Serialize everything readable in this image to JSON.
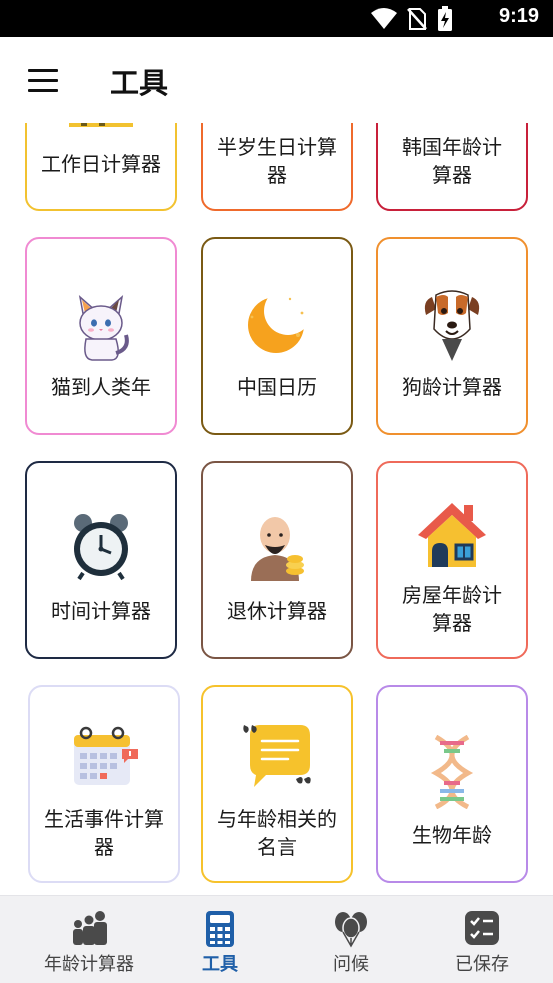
{
  "status_bar": {
    "time": "9:19",
    "icons": [
      "wifi-icon",
      "no-sim-icon",
      "battery-charging-icon"
    ]
  },
  "app_bar": {
    "menu_icon": "hamburger-menu-icon",
    "title": "工具"
  },
  "cards": [
    {
      "label": "工作日计算器",
      "icon": "workday-calendar-icon",
      "border": "#f2c230"
    },
    {
      "label": "半岁生日计算器",
      "icon": "half-birthday-icon",
      "border": "#ef6a2c"
    },
    {
      "label": "韩国年龄计算器",
      "icon": "korean-age-icon",
      "border": "#c8203a"
    },
    {
      "label": "猫到人类年",
      "icon": "cat-icon",
      "border": "#f08ad2"
    },
    {
      "label": "中国日历",
      "icon": "crescent-moon-icon",
      "border": "#7a5a14"
    },
    {
      "label": "狗龄计算器",
      "icon": "dog-icon",
      "border": "#f0902e"
    },
    {
      "label": "时间计算器",
      "icon": "alarm-clock-icon",
      "border": "#1e2a44"
    },
    {
      "label": "退休计算器",
      "icon": "retired-man-icon",
      "border": "#7a5544"
    },
    {
      "label": "房屋年龄计算器",
      "icon": "house-icon",
      "border": "#ef6a5a"
    },
    {
      "label": "生活事件计算器",
      "icon": "event-calendar-icon",
      "border": "#dcdcf5"
    },
    {
      "label": "与年龄相关的名言",
      "icon": "quote-bubble-icon",
      "border": "#f6c22c"
    },
    {
      "label": "生物年龄",
      "icon": "dna-icon",
      "border": "#b88ae8"
    }
  ],
  "bottom_nav": [
    {
      "label": "年龄计算器",
      "icon": "family-icon",
      "active": false
    },
    {
      "label": "工具",
      "icon": "calculator-icon",
      "active": true
    },
    {
      "label": "问候",
      "icon": "balloons-icon",
      "active": false
    },
    {
      "label": "已保存",
      "icon": "checklist-icon",
      "active": false
    }
  ]
}
